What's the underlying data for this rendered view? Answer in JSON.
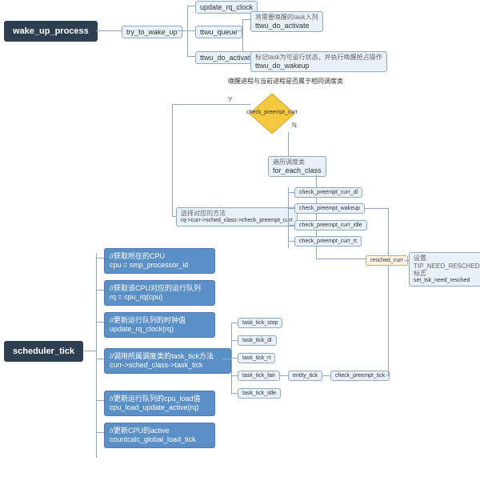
{
  "top": {
    "wake_up_process": "wake_up_process",
    "try_to_wake_up": "try_to_wake_up",
    "ttwu_queue": "ttwu_queue",
    "update_rq_clock": "update_rq_clock",
    "activate_note": "将需要唤醒的task入列",
    "ttwu_do_activate": "ttwu_do_activate",
    "wakeup_note": "标记task为可运行状态，并执行唤醒抢占操作",
    "ttwu_do_wakeup": "ttwu_do_wakeup",
    "note_same_class": "唤醒进程与当前进程是否属于相同调度类"
  },
  "decision": {
    "check_preempt_curr": "check_preempt_curr",
    "yes": "Y",
    "no": "N"
  },
  "branch_no": {
    "iter_note": "遍历调度类",
    "for_each_class": "for_each_class"
  },
  "branch_yes": {
    "select_note": "选择对应的方法",
    "select_call": "rq->curr->sched_class->check_preempt_curr",
    "items": [
      "check_preempt_curr_dl",
      "check_preempt_wakeup",
      "check_preempt_curr_idle",
      "check_preempt_curr_rt"
    ]
  },
  "resched": {
    "resched_curr": "resched_curr",
    "note": "设置TIP_NEED_RESCHED标志",
    "call": "set_tsk_need_resched"
  },
  "tick": {
    "scheduler_tick": "scheduler_tick",
    "blocks": [
      {
        "t": "//获取所在的CPU",
        "c": "cpu = smp_processor_id"
      },
      {
        "t": "//获取该CPU对应的运行队列",
        "c": "rq = cpu_rq(cpu)"
      },
      {
        "t": "//更新运行队列的时钟值",
        "c": "update_rq_clock(rq)"
      },
      {
        "t": "//调用所属调度类的task_tick方法",
        "c": "curr->sched_class->task_tick"
      },
      {
        "t": "//更新运行队列的cpu_load值",
        "c": "cpu_load_update_active(rq)"
      },
      {
        "t": "//更新CPU的active",
        "c": "countcalc_global_load_tick"
      }
    ],
    "task_ticks": [
      "task_tick_stop",
      "task_tick_dl",
      "task_tick_rt",
      "task_tick_fair",
      "task_tick_idle"
    ],
    "entity_tick": "entity_tick",
    "check_preempt_tick": "check_preempt_tick"
  }
}
